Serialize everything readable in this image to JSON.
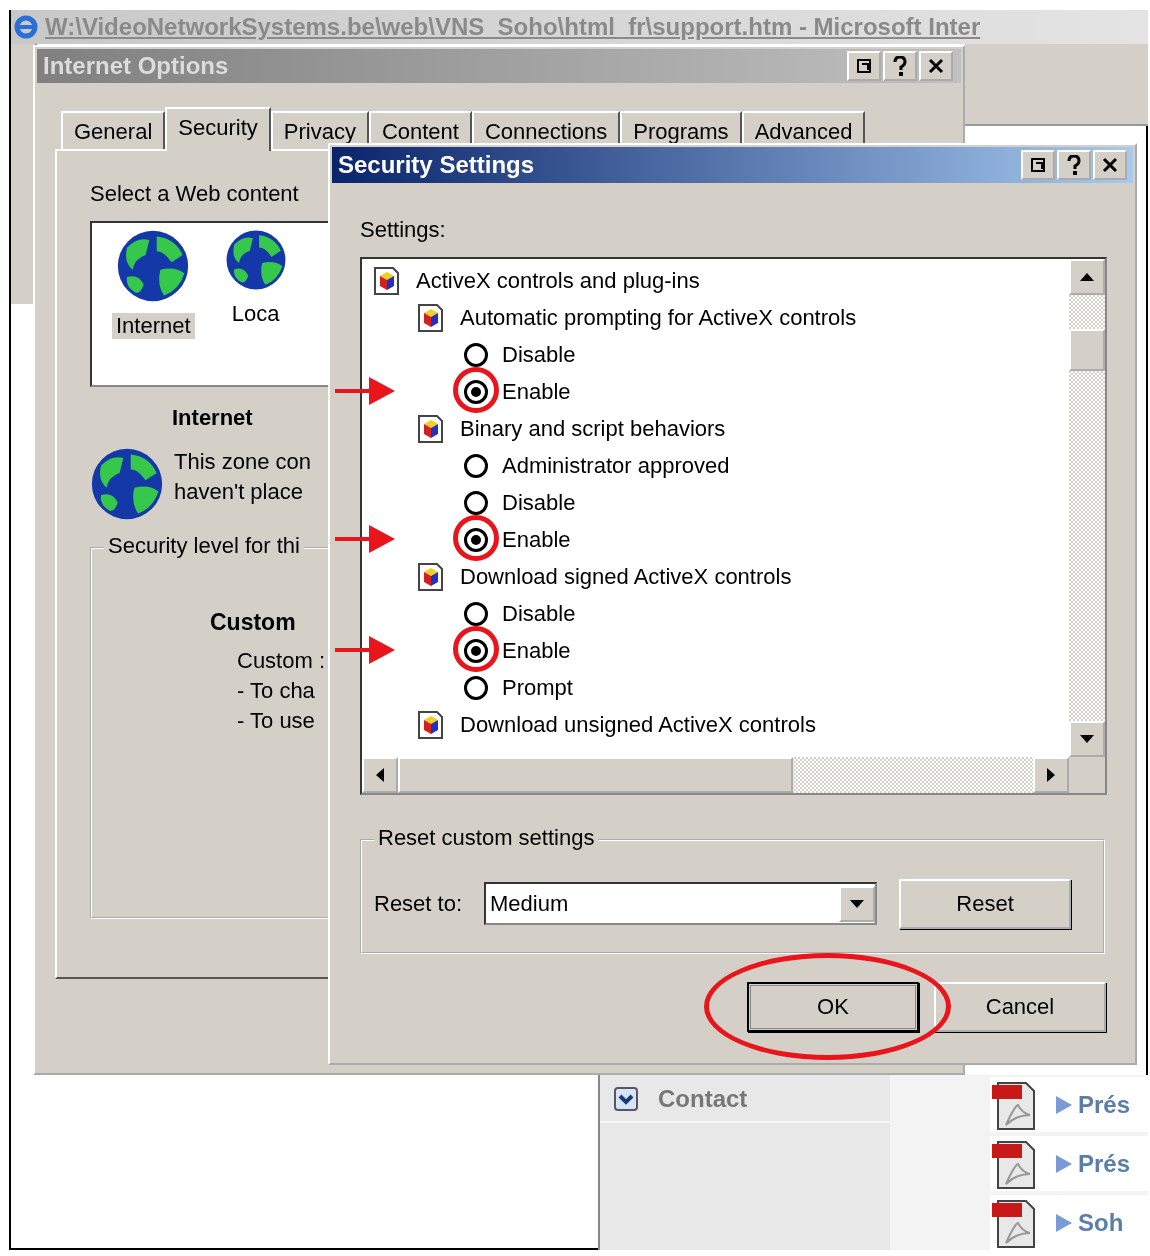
{
  "browser": {
    "title": "W:\\VideoNetworkSystems.be\\web\\VNS_Soho\\html_fr\\support.htm - Microsoft Inter",
    "sidebar_item": {
      "label": "Contact"
    },
    "links": [
      {
        "label": "Prés"
      },
      {
        "label": "Prés"
      },
      {
        "label": "Soh"
      }
    ]
  },
  "internet_options": {
    "title": "Internet Options",
    "tabs": [
      {
        "label": "General",
        "selected": false
      },
      {
        "label": "Security",
        "selected": true
      },
      {
        "label": "Privacy",
        "selected": false
      },
      {
        "label": "Content",
        "selected": false
      },
      {
        "label": "Connections",
        "selected": false
      },
      {
        "label": "Programs",
        "selected": false
      },
      {
        "label": "Advanced",
        "selected": false
      }
    ],
    "zone_prompt": "Select a Web content",
    "zones": [
      {
        "label": "Internet",
        "selected": true
      },
      {
        "label": "Loca",
        "selected": false
      }
    ],
    "zone_name": "Internet",
    "zone_description": [
      "This zone con",
      "haven't place"
    ],
    "level_group": "Security level for thi",
    "level_name": "Custom",
    "level_lines": [
      "Custom :",
      "- To cha",
      "- To use"
    ]
  },
  "security_settings": {
    "title": "Security Settings",
    "settings_label": "Settings:",
    "tree": [
      {
        "kind": "category",
        "label": "ActiveX controls and plug-ins",
        "children": [
          {
            "kind": "category",
            "label": "Automatic prompting for ActiveX controls",
            "children": [
              {
                "kind": "radio",
                "label": "Disable",
                "selected": false,
                "marked": false
              },
              {
                "kind": "radio",
                "label": "Enable",
                "selected": true,
                "marked": true
              }
            ]
          },
          {
            "kind": "category",
            "label": "Binary and script behaviors",
            "children": [
              {
                "kind": "radio",
                "label": "Administrator approved",
                "selected": false,
                "marked": false
              },
              {
                "kind": "radio",
                "label": "Disable",
                "selected": false,
                "marked": false
              },
              {
                "kind": "radio",
                "label": "Enable",
                "selected": true,
                "marked": true
              }
            ]
          },
          {
            "kind": "category",
            "label": "Download signed ActiveX controls",
            "children": [
              {
                "kind": "radio",
                "label": "Disable",
                "selected": false,
                "marked": false
              },
              {
                "kind": "radio",
                "label": "Enable",
                "selected": true,
                "marked": true
              },
              {
                "kind": "radio",
                "label": "Prompt",
                "selected": false,
                "marked": false
              }
            ]
          },
          {
            "kind": "category",
            "label": "Download unsigned ActiveX controls"
          }
        ]
      }
    ],
    "reset_group": "Reset custom settings",
    "reset_label": "Reset to:",
    "reset_value": "Medium",
    "reset_button": "Reset",
    "ok_button": {
      "label": "OK",
      "circled": true
    },
    "cancel_button": "Cancel"
  }
}
